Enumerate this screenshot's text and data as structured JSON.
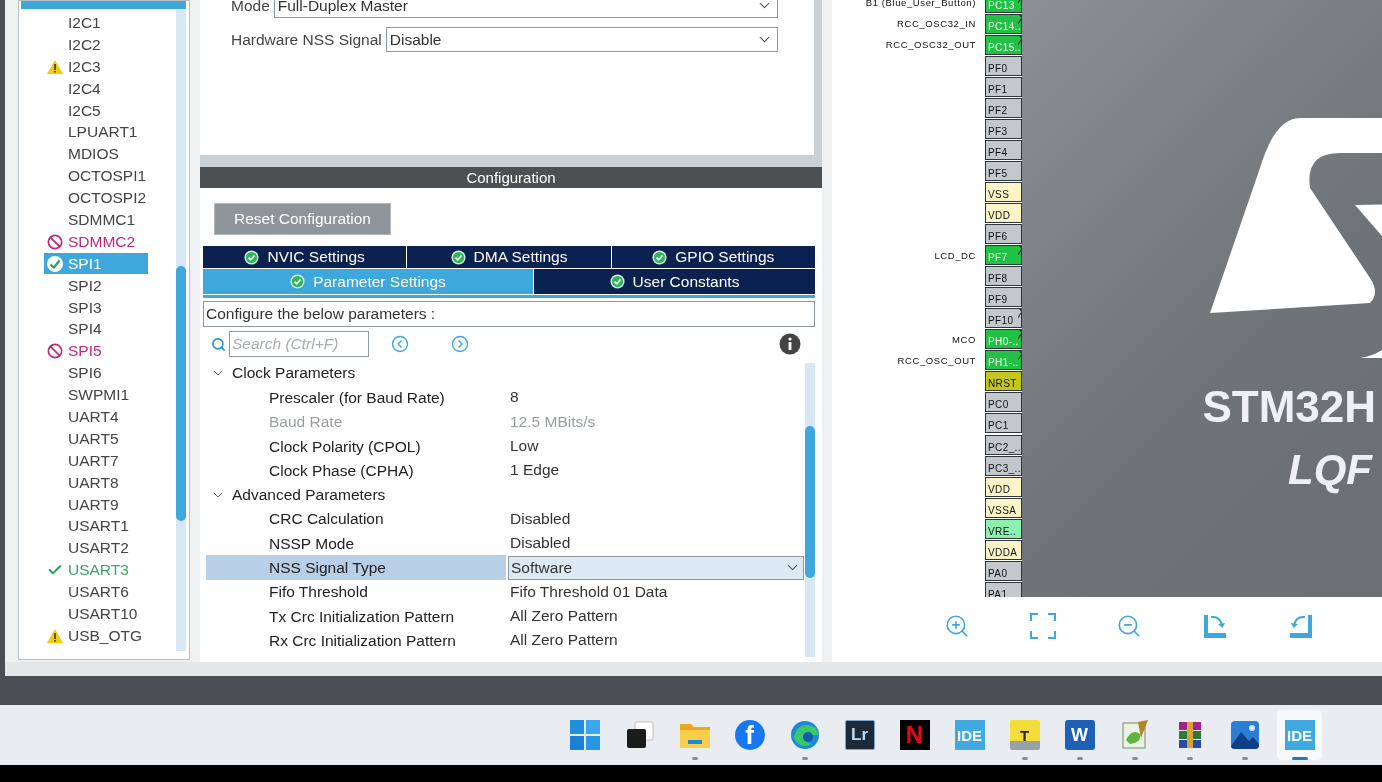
{
  "peripherals": {
    "items": [
      {
        "label": "I2C1",
        "kind": "none",
        "selected": false
      },
      {
        "label": "I2C2",
        "kind": "none",
        "selected": false
      },
      {
        "label": "I2C3",
        "kind": "warning",
        "selected": false
      },
      {
        "label": "I2C4",
        "kind": "none",
        "selected": false
      },
      {
        "label": "I2C5",
        "kind": "none",
        "selected": false
      },
      {
        "label": "LPUART1",
        "kind": "none",
        "selected": false
      },
      {
        "label": "MDIOS",
        "kind": "none",
        "selected": false
      },
      {
        "label": "OCTOSPI1",
        "kind": "none",
        "selected": false
      },
      {
        "label": "OCTOSPI2",
        "kind": "none",
        "selected": false
      },
      {
        "label": "SDMMC1",
        "kind": "none",
        "selected": false
      },
      {
        "label": "SDMMC2",
        "kind": "conflict",
        "selected": false
      },
      {
        "label": "SPI1",
        "kind": "ok",
        "selected": true
      },
      {
        "label": "SPI2",
        "kind": "none",
        "selected": false
      },
      {
        "label": "SPI3",
        "kind": "none",
        "selected": false
      },
      {
        "label": "SPI4",
        "kind": "none",
        "selected": false
      },
      {
        "label": "SPI5",
        "kind": "conflict",
        "selected": false
      },
      {
        "label": "SPI6",
        "kind": "none",
        "selected": false
      },
      {
        "label": "SWPMI1",
        "kind": "none",
        "selected": false
      },
      {
        "label": "UART4",
        "kind": "none",
        "selected": false
      },
      {
        "label": "UART5",
        "kind": "none",
        "selected": false
      },
      {
        "label": "UART7",
        "kind": "none",
        "selected": false
      },
      {
        "label": "UART8",
        "kind": "none",
        "selected": false
      },
      {
        "label": "UART9",
        "kind": "none",
        "selected": false
      },
      {
        "label": "USART1",
        "kind": "none",
        "selected": false
      },
      {
        "label": "USART2",
        "kind": "none",
        "selected": false
      },
      {
        "label": "USART3",
        "kind": "configured",
        "selected": false
      },
      {
        "label": "USART6",
        "kind": "none",
        "selected": false
      },
      {
        "label": "USART10",
        "kind": "none",
        "selected": false
      },
      {
        "label": "USB_OTG",
        "kind": "warning",
        "selected": false
      }
    ]
  },
  "mode": {
    "fields": [
      {
        "label": "Mode",
        "value": "Full-Duplex Master"
      },
      {
        "label": "Hardware NSS Signal",
        "value": "Disable"
      }
    ]
  },
  "configuration": {
    "title": "Configuration",
    "reset_button": "Reset Configuration",
    "tab_rows": [
      {
        "tabs": [
          {
            "label": "NVIC Settings",
            "selected": false
          },
          {
            "label": "DMA Settings",
            "selected": false
          },
          {
            "label": "GPIO Settings",
            "selected": false
          }
        ]
      },
      {
        "tabs": [
          {
            "label": "Parameter Settings",
            "selected": true
          },
          {
            "label": "User Constants",
            "selected": false
          }
        ]
      }
    ],
    "hint": "Configure the below parameters :",
    "search": {
      "placeholder": "Search (Ctrl+F)"
    },
    "parameters": [
      {
        "kind": "group",
        "label": "Clock Parameters",
        "expanded": true
      },
      {
        "kind": "param",
        "name": "Prescaler (for Baud Rate)",
        "value": "8",
        "disabled": false,
        "selected": false
      },
      {
        "kind": "param",
        "name": "Baud Rate",
        "value": "12.5 MBits/s",
        "disabled": true,
        "selected": false
      },
      {
        "kind": "param",
        "name": "Clock Polarity (CPOL)",
        "value": "Low",
        "disabled": false,
        "selected": false
      },
      {
        "kind": "param",
        "name": "Clock Phase (CPHA)",
        "value": "1 Edge",
        "disabled": false,
        "selected": false
      },
      {
        "kind": "group",
        "label": "Advanced Parameters",
        "expanded": true
      },
      {
        "kind": "param",
        "name": "CRC Calculation",
        "value": "Disabled",
        "disabled": false,
        "selected": false
      },
      {
        "kind": "param",
        "name": "NSSP Mode",
        "value": "Disabled",
        "disabled": false,
        "selected": false
      },
      {
        "kind": "param",
        "name": "NSS Signal Type",
        "value": "Software",
        "disabled": false,
        "selected": true
      },
      {
        "kind": "param",
        "name": "Fifo Threshold",
        "value": "Fifo Threshold 01 Data",
        "disabled": false,
        "selected": false
      },
      {
        "kind": "param",
        "name": "Tx Crc Initialization Pattern",
        "value": "All Zero Pattern",
        "disabled": false,
        "selected": false
      },
      {
        "kind": "param",
        "name": "Rx Crc Initialization Pattern",
        "value": "All Zero Pattern",
        "disabled": false,
        "selected": false
      }
    ]
  },
  "pinout": {
    "chip_name": "STM32H",
    "package": "LQF",
    "pins": [
      {
        "label": "B1 (Blue_User_Button)",
        "name": "PC13",
        "kind": "gpio",
        "pinned": true
      },
      {
        "label": "RCC_OSC32_IN",
        "name": "PC14..",
        "kind": "gpio",
        "pinned": true
      },
      {
        "label": "RCC_OSC32_OUT",
        "name": "PC15..",
        "kind": "gpio",
        "pinned": true
      },
      {
        "name": "PF0",
        "kind": "io",
        "pinned": false
      },
      {
        "name": "PF1",
        "kind": "io",
        "pinned": false
      },
      {
        "name": "PF2",
        "kind": "io",
        "pinned": false
      },
      {
        "name": "PF3",
        "kind": "io",
        "pinned": false
      },
      {
        "name": "PF4",
        "kind": "io",
        "pinned": false
      },
      {
        "name": "PF5",
        "kind": "io",
        "pinned": false
      },
      {
        "name": "VSS",
        "kind": "power",
        "pinned": false
      },
      {
        "name": "VDD",
        "kind": "power",
        "pinned": false
      },
      {
        "name": "PF6",
        "kind": "io",
        "pinned": false
      },
      {
        "label": "LCD_DC",
        "name": "PF7",
        "kind": "gpio",
        "pinned": true
      },
      {
        "name": "PF8",
        "kind": "io",
        "pinned": false
      },
      {
        "name": "PF9",
        "kind": "io",
        "pinned": false
      },
      {
        "name": "PF10",
        "kind": "io",
        "pinned": true
      },
      {
        "label": "MCO",
        "name": "PH0-..",
        "kind": "gpio",
        "pinned": true
      },
      {
        "label": "RCC_OSC_OUT",
        "name": "PH1-..",
        "kind": "gpio",
        "pinned": true
      },
      {
        "name": "NRST",
        "kind": "reset",
        "pinned": false
      },
      {
        "name": "PC0",
        "kind": "io",
        "pinned": false
      },
      {
        "name": "PC1",
        "kind": "io",
        "pinned": false
      },
      {
        "name": "PC2_..",
        "kind": "io",
        "pinned": false
      },
      {
        "name": "PC3_..",
        "kind": "io",
        "pinned": false
      },
      {
        "name": "VDD",
        "kind": "power",
        "pinned": false
      },
      {
        "name": "VSSA",
        "kind": "power",
        "pinned": false
      },
      {
        "name": "VRE..",
        "kind": "analog",
        "pinned": false
      },
      {
        "name": "VDDA",
        "kind": "power",
        "pinned": false
      },
      {
        "name": "PA0",
        "kind": "io",
        "pinned": false
      },
      {
        "name": "PA1",
        "kind": "io",
        "pinned": false
      }
    ],
    "tools": [
      {
        "kind": "zoom-in"
      },
      {
        "kind": "fit"
      },
      {
        "kind": "zoom-out"
      },
      {
        "kind": "rotate-right"
      },
      {
        "kind": "rotate-left"
      }
    ]
  },
  "taskbar": {
    "items": [
      {
        "kind": "start",
        "running": false,
        "selected": false
      },
      {
        "kind": "taskview",
        "running": false,
        "selected": false
      },
      {
        "kind": "folder",
        "running": true,
        "selected": false
      },
      {
        "kind": "facebook",
        "text": "f",
        "running": false,
        "selected": false
      },
      {
        "kind": "edge",
        "running": true,
        "selected": false
      },
      {
        "kind": "lightroom",
        "text": "Lr",
        "running": false,
        "selected": false
      },
      {
        "kind": "netflix",
        "text": "N",
        "running": false,
        "selected": false
      },
      {
        "kind": "ide",
        "text": "IDE",
        "running": false,
        "selected": false
      },
      {
        "kind": "laptop",
        "text": "T",
        "running": true,
        "selected": false
      },
      {
        "kind": "word",
        "text": "W",
        "running": true,
        "selected": false
      },
      {
        "kind": "notepad",
        "running": true,
        "selected": false
      },
      {
        "kind": "archive",
        "running": true,
        "selected": false
      },
      {
        "kind": "photos",
        "running": true,
        "selected": false
      },
      {
        "kind": "ide",
        "text": "IDE",
        "running": true,
        "selected": true
      }
    ]
  }
}
